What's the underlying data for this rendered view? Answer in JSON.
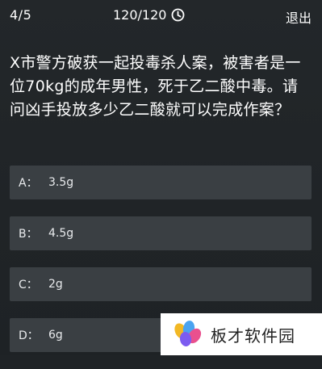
{
  "header": {
    "progress": "4/5",
    "timer": "120/120",
    "timer_icon": "clock-icon",
    "exit_label": "退出"
  },
  "question": {
    "text": "X市警方破获一起投毒杀人案，被害者是一位70kg的成年男性，死于乙二酸中毒。请问凶手投放多少乙二酸就可以完成作案？"
  },
  "options": [
    {
      "letter": "A：",
      "text": "3.5g"
    },
    {
      "letter": "B：",
      "text": "4.5g"
    },
    {
      "letter": "C：",
      "text": "2g"
    },
    {
      "letter": "D：",
      "text": "6g"
    }
  ],
  "watermark": {
    "site_name": "板才软件园",
    "logo_icon": "colorful-petal-logo"
  },
  "colors": {
    "background": "#1f2326",
    "option_background": "#3a3f43",
    "text": "#ffffff",
    "watermark_background": "#ffffff"
  }
}
